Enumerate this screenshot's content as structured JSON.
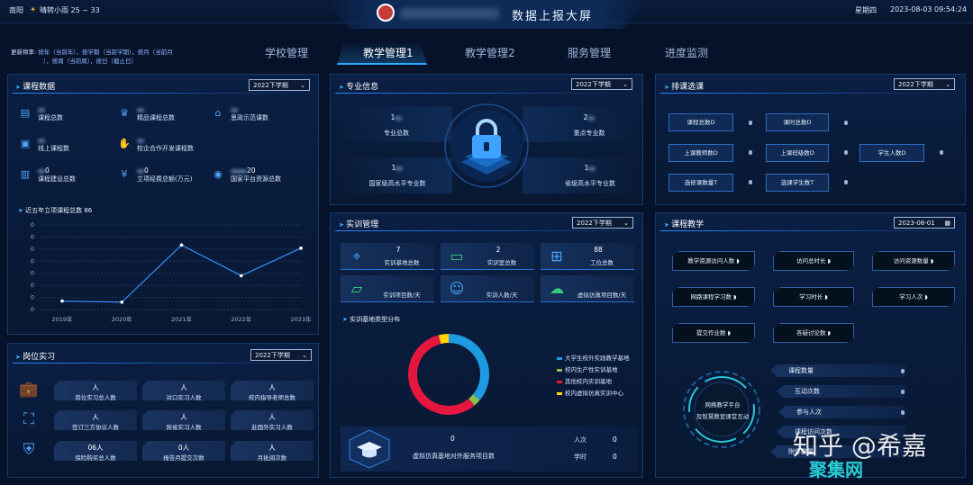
{
  "header": {
    "city": "南阳",
    "weather": "晴转小雨 25 ~ 33",
    "title": "数据上报大屏",
    "weekday": "星期四",
    "datetime": "2023-08-03 09:54:24"
  },
  "update_freq": {
    "label": "更新频率:",
    "line1": "按年（当前年），按学期（当前学期），按月（当前月",
    "line2": "），按周（当前周），按日（截止日）"
  },
  "nav": {
    "tabs": [
      "学校管理",
      "教学管理1",
      "教学管理2",
      "服务管理",
      "进度监测"
    ],
    "active": "教学管理1"
  },
  "course_data": {
    "title": "课程数据",
    "semester": "2022下学期",
    "items": [
      {
        "icon": "book-icon",
        "value": "",
        "label": "课程总数"
      },
      {
        "icon": "crown-icon",
        "value": "",
        "label": "精品课程总数"
      },
      {
        "icon": "institution-icon",
        "value": "",
        "label": "思政示范课数"
      },
      {
        "icon": "monitor-icon",
        "value": "",
        "label": "线上课程数"
      },
      {
        "icon": "handshake-icon",
        "value": "",
        "label": "校企合作开发课程数"
      },
      {
        "icon": "building-icon",
        "value": "0",
        "label": "课程建设总数"
      },
      {
        "icon": "money-icon",
        "value": "0",
        "label": "立项经费总额(万元)"
      },
      {
        "icon": "globe-icon",
        "value": "20",
        "label": "国家平台资源总数"
      }
    ],
    "chart_title": "近五年立项课程总数 86"
  },
  "chart_data": {
    "type": "line",
    "categories": [
      "2019年",
      "2020年",
      "2021年",
      "2022年",
      "2023年"
    ],
    "values": [
      8,
      7,
      61,
      32,
      58
    ],
    "y_tick_labels": [
      "0",
      "0",
      "0",
      "0",
      "0",
      "0",
      "0",
      "0"
    ],
    "ylim": [
      0,
      80
    ],
    "color": "#3b8cff"
  },
  "internship": {
    "title": "岗位实习",
    "semester": "2022下学期",
    "rows": [
      {
        "icon": "briefcase-icon",
        "cells": [
          {
            "value": "人",
            "label": "岗位实习总人数"
          },
          {
            "value": "人",
            "label": "对口实习人数"
          },
          {
            "value": "人",
            "label": "校内指导老师总数"
          }
        ]
      },
      {
        "icon": "map-icon",
        "cells": [
          {
            "value": "人",
            "label": "签订三方协议人数"
          },
          {
            "value": "人",
            "label": "跨省实习人数"
          },
          {
            "value": "人",
            "label": "赴国外实习人数"
          }
        ]
      },
      {
        "icon": "shield-icon",
        "cells": [
          {
            "value": "06人",
            "label": "保险购买总人数"
          },
          {
            "value": "0人",
            "label": "报告月提交次数"
          },
          {
            "value": "人",
            "label": "月批阅次数"
          }
        ]
      }
    ]
  },
  "professional": {
    "title": "专业信息",
    "semester": "2022下学期",
    "items": [
      {
        "value": "1",
        "label": "专业总数"
      },
      {
        "value": "2",
        "label": "重点专业数"
      },
      {
        "value": "1",
        "label": "国家级高水平专业数"
      },
      {
        "value": "1",
        "label": "省级高水平专业数"
      }
    ]
  },
  "training": {
    "title": "实训管理",
    "semester": "2022下学期",
    "tiles": [
      {
        "icon": "map-pin-icon",
        "value": "7",
        "label": "实训基地总数",
        "color": "#4ba7ff"
      },
      {
        "icon": "laptop-icon",
        "value": "2",
        "label": "实训室总数",
        "color": "#39d07a"
      },
      {
        "icon": "workstation-icon",
        "value": "88",
        "label": "工位总数",
        "color": "#4ba7ff"
      },
      {
        "icon": "folder-icon",
        "value": "",
        "label": "实训项目数/天",
        "color": "#39d07a"
      },
      {
        "icon": "person-icon",
        "value": "",
        "label": "实训人数/天",
        "color": "#4ba7ff"
      },
      {
        "icon": "cloud-icon",
        "value": "",
        "label": "虚拟仿真项目数/天",
        "color": "#39d07a"
      }
    ],
    "donut_title": "实训基地类型分布",
    "legend": [
      {
        "label": "大学生校外实践教学基地",
        "color": "#1e9be0"
      },
      {
        "label": "校内生产性实训基地",
        "color": "#8bc34a"
      },
      {
        "label": "其他校内实训基地",
        "color": "#e5173f"
      },
      {
        "label": "校内虚拟仿真实训中心",
        "color": "#ffd400"
      }
    ],
    "donut": [
      {
        "label": "大学生校外实践教学基地",
        "value": 36,
        "color": "#1e9be0"
      },
      {
        "label": "校内生产性实训基地",
        "value": 3,
        "color": "#8bc34a"
      },
      {
        "label": "其他校内实训基地",
        "value": 57,
        "color": "#e5173f"
      },
      {
        "label": "校内虚拟仿真实训中心",
        "value": 4,
        "color": "#ffd400"
      }
    ],
    "virtual": {
      "value": "0",
      "label": "虚拟仿真基地对外服务项目数",
      "person_label": "人次",
      "person_value": "0",
      "hours_label": "学时",
      "hours_value": "0"
    }
  },
  "scheduling": {
    "title": "排课选课",
    "semester": "2022下学期",
    "buttons": [
      "课程总数D",
      "课时总数D",
      "上课教师数D",
      "上课班级数D",
      "学生人数D",
      "选修课数量T",
      "选课学生数T"
    ]
  },
  "teaching": {
    "title": "课程教学",
    "date": "2023-08-01",
    "buttons": [
      "教学资源访问人数",
      "访问总时长",
      "访问资源数量",
      "网路课程学习数",
      "学习时长",
      "学习人次",
      "提交作业数",
      "答疑讨论数"
    ],
    "ring": {
      "line1": "网络教学平台",
      "line2": "及智慧教室课堂互动"
    },
    "list": [
      "课程数量",
      "互动次数",
      "参与人次",
      "课程访问次数",
      "附件数量"
    ]
  },
  "watermark": {
    "line1": "知乎 @希嘉",
    "line2": "聚集网"
  }
}
